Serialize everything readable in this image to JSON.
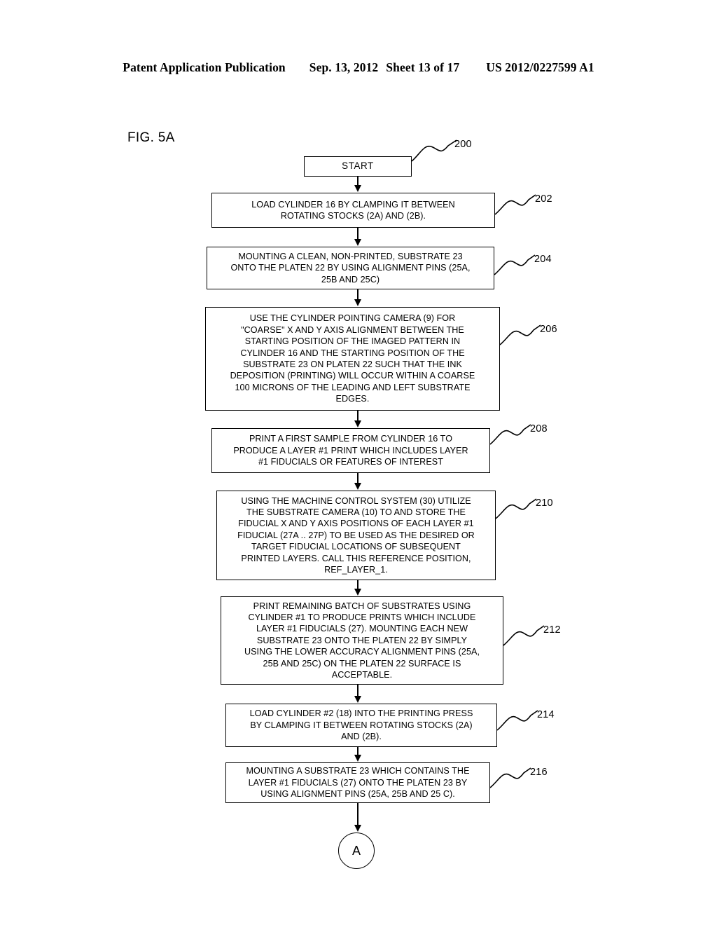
{
  "header": {
    "publication": "Patent Application Publication",
    "date": "Sep. 13, 2012",
    "sheet": "Sheet 13 of 17",
    "patent_number": "US 2012/0227599 A1"
  },
  "figure": {
    "label": "FIG. 5A"
  },
  "flowchart": {
    "nodes": [
      {
        "id": "start",
        "ref": "200",
        "shape": "terminator",
        "text": "START"
      },
      {
        "id": "step-202",
        "ref": "202",
        "shape": "process",
        "text": "LOAD CYLINDER 16 BY CLAMPING IT BETWEEN\nROTATING STOCKS (2A) AND (2B)."
      },
      {
        "id": "step-204",
        "ref": "204",
        "shape": "process",
        "text": "MOUNTING A CLEAN, NON-PRINTED, SUBSTRATE 23\nONTO THE PLATEN 22 BY USING ALIGNMENT PINS (25A,\n25B AND 25C)"
      },
      {
        "id": "step-206",
        "ref": "206",
        "shape": "process",
        "text": "USE THE CYLINDER POINTING CAMERA (9) FOR\n\"COARSE\" X AND Y AXIS ALIGNMENT BETWEEN THE\nSTARTING POSITION OF THE IMAGED PATTERN IN\nCYLINDER  16 AND THE STARTING POSITION OF THE\nSUBSTRATE 23 ON PLATEN 22 SUCH THAT THE INK\nDEPOSITION (PRINTING) WILL OCCUR WITHIN A COARSE\n100 MICRONS OF THE LEADING AND LEFT SUBSTRATE\nEDGES."
      },
      {
        "id": "step-208",
        "ref": "208",
        "shape": "process",
        "text": "PRINT A FIRST SAMPLE FROM CYLINDER 16 TO\nPRODUCE A LAYER #1 PRINT WHICH INCLUDES LAYER\n#1 FIDUCIALS OR FEATURES OF INTEREST"
      },
      {
        "id": "step-210",
        "ref": "210",
        "shape": "process",
        "text": "USING THE MACHINE CONTROL SYSTEM (30) UTILIZE\nTHE SUBSTRATE CAMERA (10) TO AND STORE THE\nFIDUCIAL X AND Y AXIS POSITIONS OF EACH LAYER #1\nFIDUCIAL (27A .. 27P) TO BE USED AS THE DESIRED OR\nTARGET FIDUCIAL LOCATIONS OF SUBSEQUENT\nPRINTED LAYERS.  CALL THIS REFERENCE POSITION,\nREF_LAYER_1."
      },
      {
        "id": "step-212",
        "ref": "212",
        "shape": "process",
        "text": "PRINT REMAINING BATCH OF SUBSTRATES USING\nCYLINDER #1 TO PRODUCE PRINTS WHICH INCLUDE\nLAYER #1 FIDUCIALS (27). MOUNTING EACH NEW\nSUBSTRATE 23 ONTO THE PLATEN 22 BY SIMPLY\nUSING THE LOWER ACCURACY ALIGNMENT PINS (25A,\n25B AND 25C) ON THE PLATEN 22 SURFACE IS\nACCEPTABLE."
      },
      {
        "id": "step-214",
        "ref": "214",
        "shape": "process",
        "text": "LOAD CYLINDER #2 (18) INTO THE PRINTING PRESS\nBY CLAMPING IT BETWEEN ROTATING STOCKS (2A)\nAND (2B)."
      },
      {
        "id": "step-216",
        "ref": "216",
        "shape": "process",
        "text": "MOUNTING A SUBSTRATE 23 WHICH CONTAINS THE\nLAYER #1 FIDUCIALS (27) ONTO THE PLATEN 23 BY\nUSING ALIGNMENT PINS (25A, 25B AND 25 C)."
      },
      {
        "id": "connector-a",
        "ref": "",
        "shape": "connector",
        "text": "A"
      }
    ]
  },
  "colors": {
    "line": "#000000",
    "background": "#ffffff"
  }
}
